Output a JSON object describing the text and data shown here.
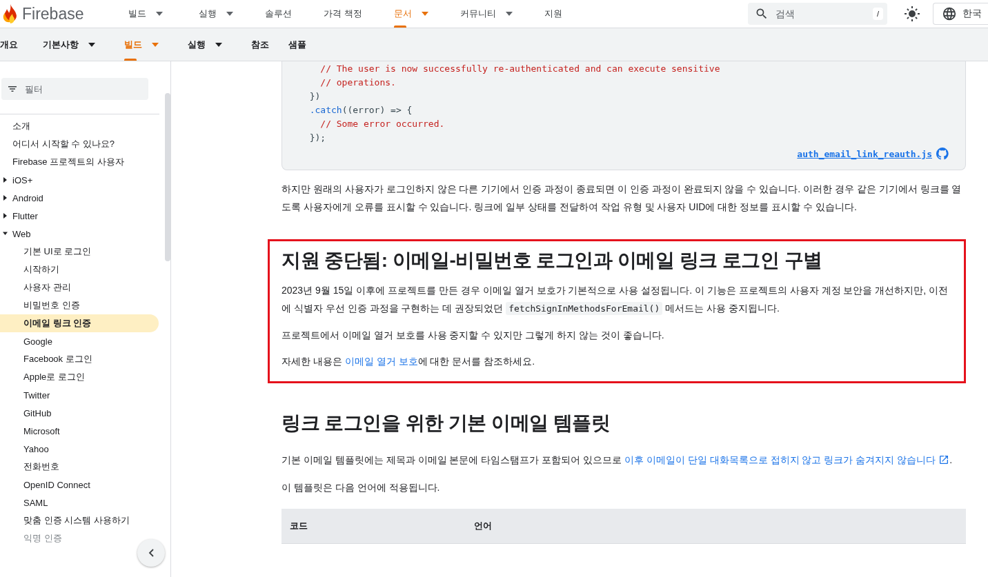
{
  "header": {
    "logo": "Firebase",
    "nav": [
      {
        "label": "빌드",
        "dropdown": true,
        "selected": false
      },
      {
        "label": "실행",
        "dropdown": true,
        "selected": false
      },
      {
        "label": "솔루션",
        "dropdown": false,
        "selected": false
      },
      {
        "label": "가격 책정",
        "dropdown": false,
        "selected": false
      },
      {
        "label": "문서",
        "dropdown": true,
        "selected": true
      },
      {
        "label": "커뮤니티",
        "dropdown": true,
        "selected": false
      },
      {
        "label": "지원",
        "dropdown": false,
        "selected": false
      }
    ],
    "search": {
      "placeholder": "검색",
      "shortcut": "/"
    },
    "language": "한국"
  },
  "subnav": [
    {
      "label": "개요",
      "dropdown": false,
      "selected": false
    },
    {
      "label": "기본사항",
      "dropdown": true,
      "selected": false
    },
    {
      "label": "빌드",
      "dropdown": true,
      "selected": true
    },
    {
      "label": "실행",
      "dropdown": true,
      "selected": false
    },
    {
      "label": "참조",
      "dropdown": false,
      "selected": false
    },
    {
      "label": "샘플",
      "dropdown": false,
      "selected": false
    }
  ],
  "sidebar": {
    "filter": {
      "placeholder": "필터"
    },
    "items": [
      {
        "label": "소개",
        "selected": false
      },
      {
        "label": "어디서 시작할 수 있나요?",
        "selected": false
      },
      {
        "label": "Firebase 프로젝트의 사용자",
        "selected": false
      },
      {
        "label": "iOS+",
        "selected": false,
        "expanded": false
      },
      {
        "label": "Android",
        "selected": false,
        "expanded": false
      },
      {
        "label": "Flutter",
        "selected": false,
        "expanded": false
      },
      {
        "label": "Web",
        "selected": false,
        "expanded": true,
        "children": [
          {
            "label": "기본 UI로 로그인",
            "selected": false
          },
          {
            "label": "시작하기",
            "selected": false
          },
          {
            "label": "사용자 관리",
            "selected": false
          },
          {
            "label": "비밀번호 인증",
            "selected": false
          },
          {
            "label": "이메일 링크 인증",
            "selected": true
          },
          {
            "label": "Google",
            "selected": false
          },
          {
            "label": "Facebook 로그인",
            "selected": false
          },
          {
            "label": "Apple로 로그인",
            "selected": false
          },
          {
            "label": "Twitter",
            "selected": false
          },
          {
            "label": "GitHub",
            "selected": false
          },
          {
            "label": "Microsoft",
            "selected": false
          },
          {
            "label": "Yahoo",
            "selected": false
          },
          {
            "label": "전화번호",
            "selected": false
          },
          {
            "label": "OpenID Connect",
            "selected": false
          },
          {
            "label": "SAML",
            "selected": false
          },
          {
            "label": "맞춤 인증 시스템 사용하기",
            "selected": false
          },
          {
            "label": "익명 인증",
            "selected": false
          }
        ]
      }
    ]
  },
  "code": {
    "lines": [
      [
        {
          "kind": "comment",
          "text": "    // The user is now successfully re-authenticated and can execute sensitive"
        }
      ],
      [
        {
          "kind": "comment",
          "text": "    // operations."
        }
      ],
      [
        {
          "kind": "plain",
          "text": "  })"
        }
      ],
      [
        {
          "kind": "method",
          "text": "  .catch"
        },
        {
          "kind": "plain",
          "text": "((error) => {"
        }
      ],
      [
        {
          "kind": "comment",
          "text": "    // Some error occurred."
        }
      ],
      [
        {
          "kind": "plain",
          "text": "  });"
        }
      ]
    ],
    "file": "auth_email_link_reauth.js"
  },
  "intro": [
    {
      "kind": "text",
      "text": "하지만 원래의 사용자가 로그인하지 않은 다른 기기에서 인증 과정이 종료되면 이 인증 과정이 완료되지 않을 수 있습니다. 이러한 경우 같은 기기에서 링크를 열도록 사용자에게 오류를 표시할 수 있습니다. 링크에 일부 상태를 전달하여 작업 유형 및 사용자 UID에 대한 정보를 표시할 수 있습니다."
    }
  ],
  "highlighted_section": {
    "heading": "지원 중단됨: 이메일-비밀번호 로그인과 이메일 링크 로그인 구별",
    "paragraphs": [
      [
        {
          "kind": "text",
          "text": "2023년 9월 15일 이후에 프로젝트를 만든 경우 이메일 열거 보호가 기본적으로 사용 설정됩니다. 이 기능은 프로젝트의 사용자 계정 보안을 개선하지만, 이전에 식별자 우선 인증 과정을 구현하는 데 권장되었던 "
        },
        {
          "kind": "code",
          "text": "fetchSignInMethodsForEmail()"
        },
        {
          "kind": "text",
          "text": " 메서드는 사용 중지됩니다."
        }
      ],
      [
        {
          "kind": "text",
          "text": "프로젝트에서 이메일 열거 보호를 사용 중지할 수 있지만 그렇게 하지 않는 것이 좋습니다."
        }
      ],
      [
        {
          "kind": "text",
          "text": "자세한 내용은 "
        },
        {
          "kind": "link",
          "text": "이메일 열거 보호"
        },
        {
          "kind": "text",
          "text": "에 대한 문서를 참조하세요."
        }
      ]
    ]
  },
  "section": {
    "heading": "링크 로그인을 위한 기본 이메일 템플릿",
    "paragraphs": [
      [
        {
          "kind": "text",
          "text": "기본 이메일 템플릿에는 제목과 이메일 본문에 타임스탬프가 포함되어 있으므로 "
        },
        {
          "kind": "link",
          "text": "이후 이메일이 단일 대화목록으로 접히지 않고 링크가 숨겨지지 않습니다",
          "external": true
        },
        {
          "kind": "text",
          "text": "."
        }
      ],
      [
        {
          "kind": "text",
          "text": "이 템플릿은 다음 언어에 적용됩니다."
        }
      ]
    ],
    "table": {
      "columns": [
        "코드",
        "언어"
      ]
    }
  }
}
